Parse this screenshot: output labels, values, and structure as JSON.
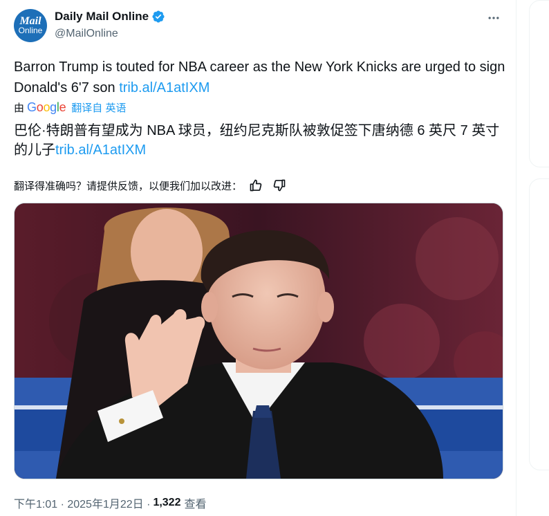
{
  "tweet": {
    "author": {
      "display_name": "Daily Mail Online",
      "handle": "@MailOnline",
      "avatar_line1": "Mail",
      "avatar_line2": "Online",
      "verified": true
    },
    "text_before_link": "Barron Trump is touted for NBA career as the New York Knicks are urged to sign Donald's 6'7 son ",
    "link": "trib.al/A1atIXM",
    "translation_prefix": "由",
    "translation_provider": "Google",
    "translation_source": "翻译自 英语",
    "translated_text_before_link": "巴伦·特朗普有望成为 NBA 球员，纽约尼克斯队被敦促签下唐纳德 6 英尺 7 英寸的儿子",
    "translated_link": "trib.al/A1atIXM",
    "feedback_prompt": "翻译得准确吗？请提供反馈，以便我们加以改进：",
    "time": "下午1:01 · 2025年1月22日 ·",
    "views_count": "1,322",
    "views_label": "查看"
  },
  "icons": {
    "verified": "verified-badge-icon",
    "more": "more-horizontal-icon",
    "thumbs_up": "thumbs-up-icon",
    "thumbs_down": "thumbs-down-icon"
  },
  "colors": {
    "accent": "#1d9bf0",
    "text_primary": "#0f1419",
    "text_secondary": "#536471",
    "avatar_bg": "#1d6fb8"
  }
}
